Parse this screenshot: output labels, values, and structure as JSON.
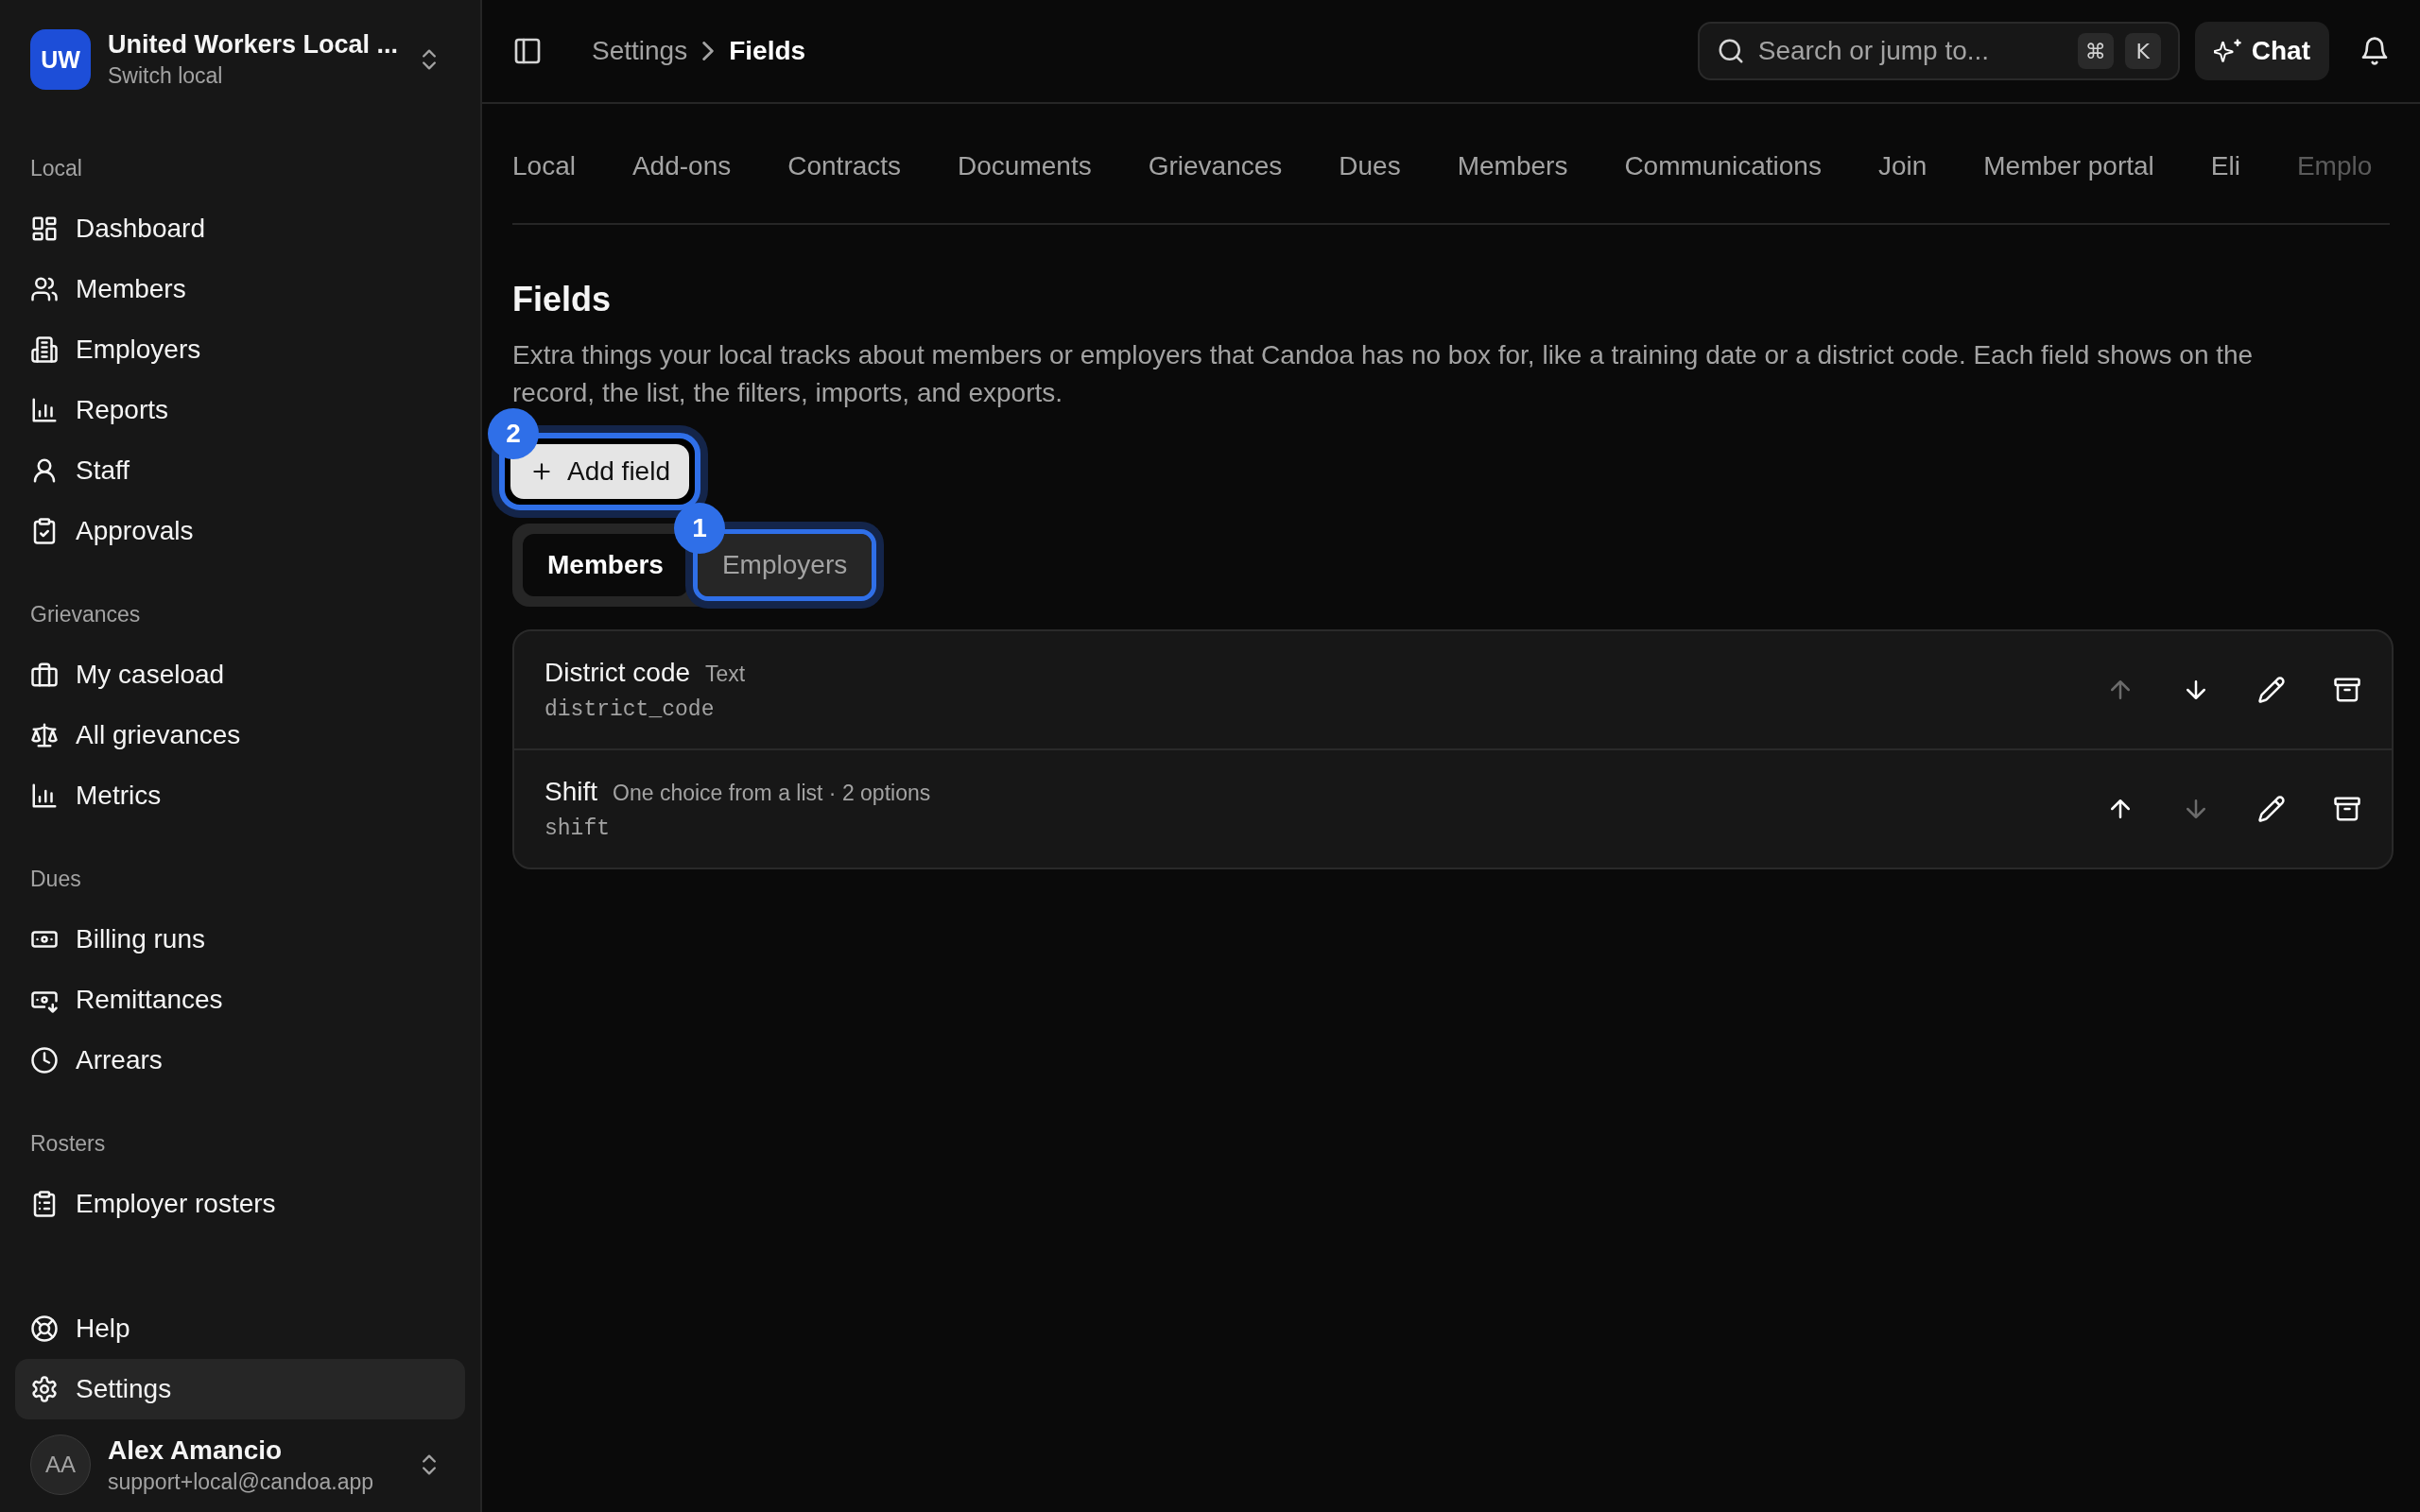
{
  "sidebar": {
    "workspace": {
      "initials": "UW",
      "name": "United Workers Local ...",
      "subtitle": "Switch local"
    },
    "sections": [
      {
        "title": "Local",
        "items": [
          {
            "label": "Dashboard",
            "selected": false
          },
          {
            "label": "Members",
            "selected": false
          },
          {
            "label": "Employers",
            "selected": false
          },
          {
            "label": "Reports",
            "selected": false
          },
          {
            "label": "Staff",
            "selected": false
          },
          {
            "label": "Approvals",
            "selected": false
          }
        ]
      },
      {
        "title": "Grievances",
        "items": [
          {
            "label": "My caseload",
            "selected": false
          },
          {
            "label": "All grievances",
            "selected": false
          },
          {
            "label": "Metrics",
            "selected": false
          }
        ]
      },
      {
        "title": "Dues",
        "items": [
          {
            "label": "Billing runs",
            "selected": false
          },
          {
            "label": "Remittances",
            "selected": false
          },
          {
            "label": "Arrears",
            "selected": false
          }
        ]
      },
      {
        "title": "Rosters",
        "items": [
          {
            "label": "Employer rosters",
            "selected": false
          }
        ]
      }
    ],
    "bottom_items": [
      {
        "label": "Help",
        "selected": false
      },
      {
        "label": "Settings",
        "selected": true
      }
    ],
    "user": {
      "initials": "AA",
      "name": "Alex Amancio",
      "email": "support+local@candoa.app"
    }
  },
  "topbar": {
    "breadcrumb": [
      "Settings",
      "Fields"
    ],
    "search": {
      "placeholder": "Search or jump to...",
      "keys": [
        "⌘",
        "K"
      ]
    },
    "chat_button": "Chat"
  },
  "tabs": [
    {
      "label": "Local",
      "selected": false
    },
    {
      "label": "Add-ons",
      "selected": false
    },
    {
      "label": "Contracts",
      "selected": false
    },
    {
      "label": "Documents",
      "selected": false
    },
    {
      "label": "Grievances",
      "selected": false
    },
    {
      "label": "Dues",
      "selected": false
    },
    {
      "label": "Members",
      "selected": false
    },
    {
      "label": "Communications",
      "selected": false
    },
    {
      "label": "Join",
      "selected": false
    },
    {
      "label": "Member portal",
      "selected": false
    },
    {
      "label": "Eli",
      "selected": false
    },
    {
      "label": "Emplo",
      "selected": false
    }
  ],
  "page": {
    "title": "Fields",
    "description": "Extra things your local tracks about members or employers that Candoa has no box for, like a training date or a district code. Each field shows on the record, the list, the filters, imports, and exports.",
    "add_button": {
      "label": "Add field",
      "highlighted": true,
      "marker": "2"
    },
    "segments": [
      {
        "label": "Members",
        "selected": true,
        "highlighted": false
      },
      {
        "label": "Employers",
        "selected": false,
        "highlighted": true,
        "marker": "1"
      }
    ],
    "fields": [
      {
        "name": "District code",
        "type": "Text",
        "key": "district_code",
        "up_disabled": true,
        "down_disabled": false
      },
      {
        "name": "Shift",
        "type": "One choice from a list · 2 options",
        "key": "shift",
        "up_disabled": false,
        "down_disabled": true
      }
    ]
  }
}
